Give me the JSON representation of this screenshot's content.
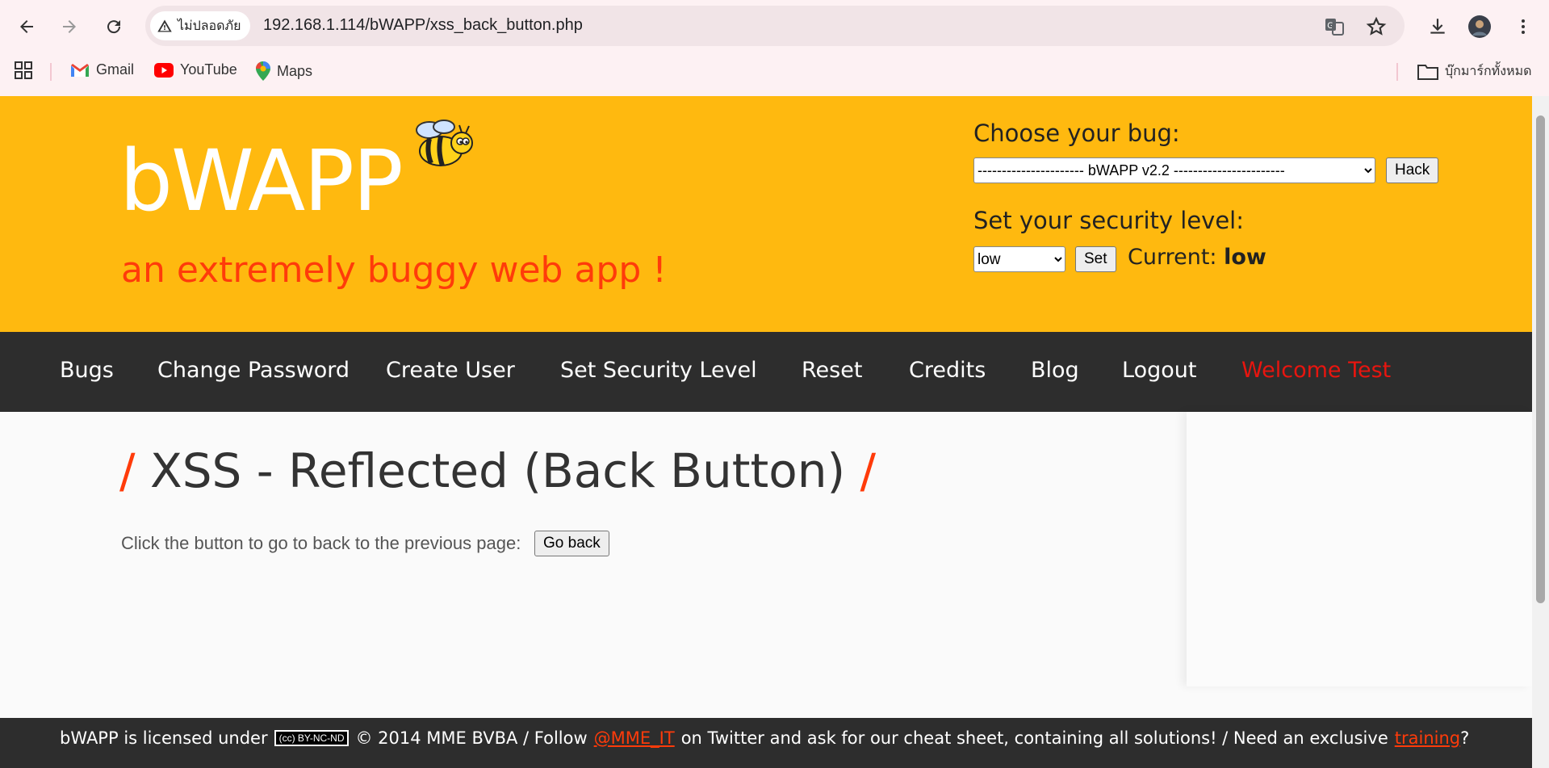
{
  "browser": {
    "security_chip": "ไม่ปลอดภัย",
    "url": "192.168.1.114/bWAPP/xss_back_button.php",
    "bookmarks": [
      {
        "label": "Gmail"
      },
      {
        "label": "YouTube"
      },
      {
        "label": "Maps"
      }
    ],
    "all_bookmarks": "บุ๊กมาร์กทั้งหมด"
  },
  "header": {
    "logo": "bWAPP",
    "tagline": "an extremely buggy web app !",
    "choose_bug_label": "Choose your bug:",
    "bug_select_value": "---------------------- bWAPP v2.2 -----------------------",
    "hack_button": "Hack",
    "security_label": "Set your security level:",
    "security_select_value": "low",
    "set_button": "Set",
    "current_label": "Current:",
    "current_value": "low"
  },
  "menu": {
    "items": [
      {
        "label": "Bugs"
      },
      {
        "label": "Change Password"
      },
      {
        "label": "Create User"
      },
      {
        "label": "Set Security Level"
      },
      {
        "label": "Reset"
      },
      {
        "label": "Credits"
      },
      {
        "label": "Blog"
      },
      {
        "label": "Logout"
      },
      {
        "label": "Welcome Test"
      }
    ]
  },
  "content": {
    "slash": "/",
    "title": "XSS - Reflected (Back Button)",
    "text": "Click the button to go to back to the previous page:",
    "go_back_button": "Go back"
  },
  "footer": {
    "licensed": "bWAPP is licensed under",
    "cc_badge": "BY-NC-ND",
    "copyright": "© 2014 MME BVBA / Follow",
    "twitter_link": "@MME_IT",
    "middle": "on Twitter and ask for our cheat sheet, containing all solutions! / Need an exclusive",
    "training_link": "training",
    "end": "?"
  },
  "colors": {
    "header_bg": "#ffb90f",
    "menu_bg": "#2d2d2d",
    "accent": "#ff3b0a",
    "welcome": "#e8150f"
  }
}
